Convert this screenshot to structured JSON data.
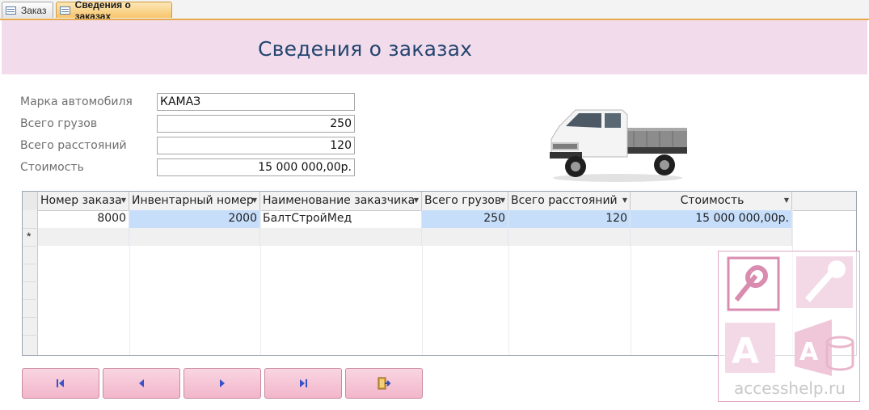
{
  "tabs": [
    {
      "label": "Заказ",
      "active": false
    },
    {
      "label": "Сведения о заказах",
      "active": true
    }
  ],
  "header": {
    "title": "Сведения о заказах"
  },
  "form": {
    "fields": [
      {
        "label": "Марка автомобиля",
        "value": "КАМАЗ"
      },
      {
        "label": "Всего грузов",
        "value": "250"
      },
      {
        "label": "Всего расстояний",
        "value": "120"
      },
      {
        "label": "Стоимость",
        "value": "15 000 000,00р."
      }
    ]
  },
  "grid": {
    "columns": [
      "Номер заказа",
      "Инвентарный номер",
      "Наименование заказчика",
      "Всего грузов",
      "Всего расстояний",
      "Стоимость"
    ],
    "rows": [
      [
        "8000",
        "2000",
        "БалтСтройМед",
        "250",
        "120",
        "15 000 000,00р."
      ]
    ],
    "new_row_marker": "*"
  },
  "nav_buttons": [
    {
      "icon": "first-record-icon"
    },
    {
      "icon": "previous-record-icon"
    },
    {
      "icon": "next-record-icon"
    },
    {
      "icon": "last-record-icon"
    },
    {
      "icon": "exit-icon"
    }
  ],
  "watermark": {
    "text": "accesshelp.ru"
  },
  "colors": {
    "header_band": "#f2dcec",
    "title": "#24456f",
    "button": "#f2b6cb",
    "selection": "#c6defa",
    "tab_active": "#f7c56b"
  }
}
